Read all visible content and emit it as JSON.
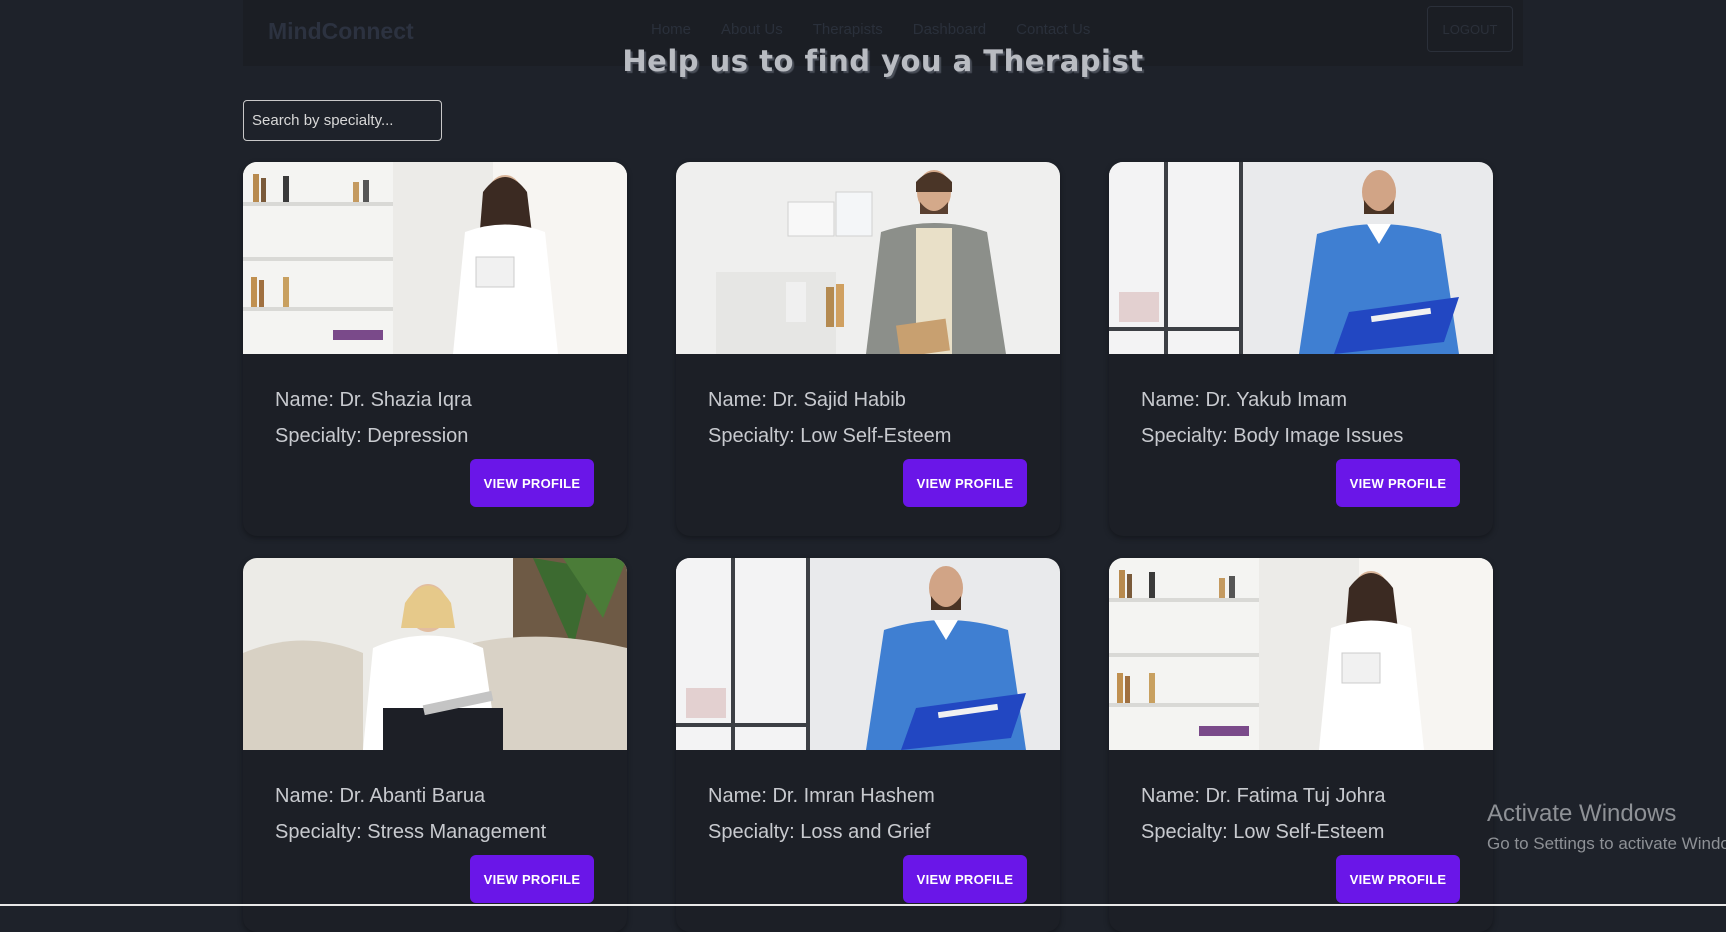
{
  "app": {
    "brand": "MindConnect",
    "page_title": "Help us to find you a Therapist"
  },
  "navbar": {
    "links": [
      "Home",
      "About Us",
      "Therapists",
      "Dashboard",
      "Contact Us"
    ],
    "logout_label": "LOGOUT"
  },
  "search": {
    "placeholder": "Search by specialty..."
  },
  "therapists": [
    {
      "name": "Name: Dr. Shazia Iqra",
      "specialty": "Specialty: Depression",
      "button": "VIEW PROFILE",
      "photo": "woman-office-photo"
    },
    {
      "name": "Name: Dr. Sajid Habib",
      "specialty": "Specialty: Low Self-Esteem",
      "button": "VIEW PROFILE",
      "photo": "man-blazer-photo"
    },
    {
      "name": "Name: Dr. Yakub Imam",
      "specialty": "Specialty: Body Image Issues",
      "button": "VIEW PROFILE",
      "photo": "man-scrubs-photo"
    },
    {
      "name": "Name: Dr. Abanti Barua",
      "specialty": "Specialty: Stress Management",
      "button": "VIEW PROFILE",
      "photo": "woman-sofa-photo"
    },
    {
      "name": "Name: Dr. Imran Hashem",
      "specialty": "Specialty: Loss and Grief",
      "button": "VIEW PROFILE",
      "photo": "man-scrubs-photo"
    },
    {
      "name": "Name: Dr. Fatima Tuj Johra",
      "specialty": "Specialty: Low Self-Esteem",
      "button": "VIEW PROFILE",
      "photo": "woman-office-photo"
    }
  ],
  "os_watermark": {
    "title": "Activate Windows",
    "subtitle": "Go to Settings to activate Windows."
  },
  "colors": {
    "background": "#1e222a",
    "card": "#1c1f26",
    "button": "#6a16e8"
  }
}
